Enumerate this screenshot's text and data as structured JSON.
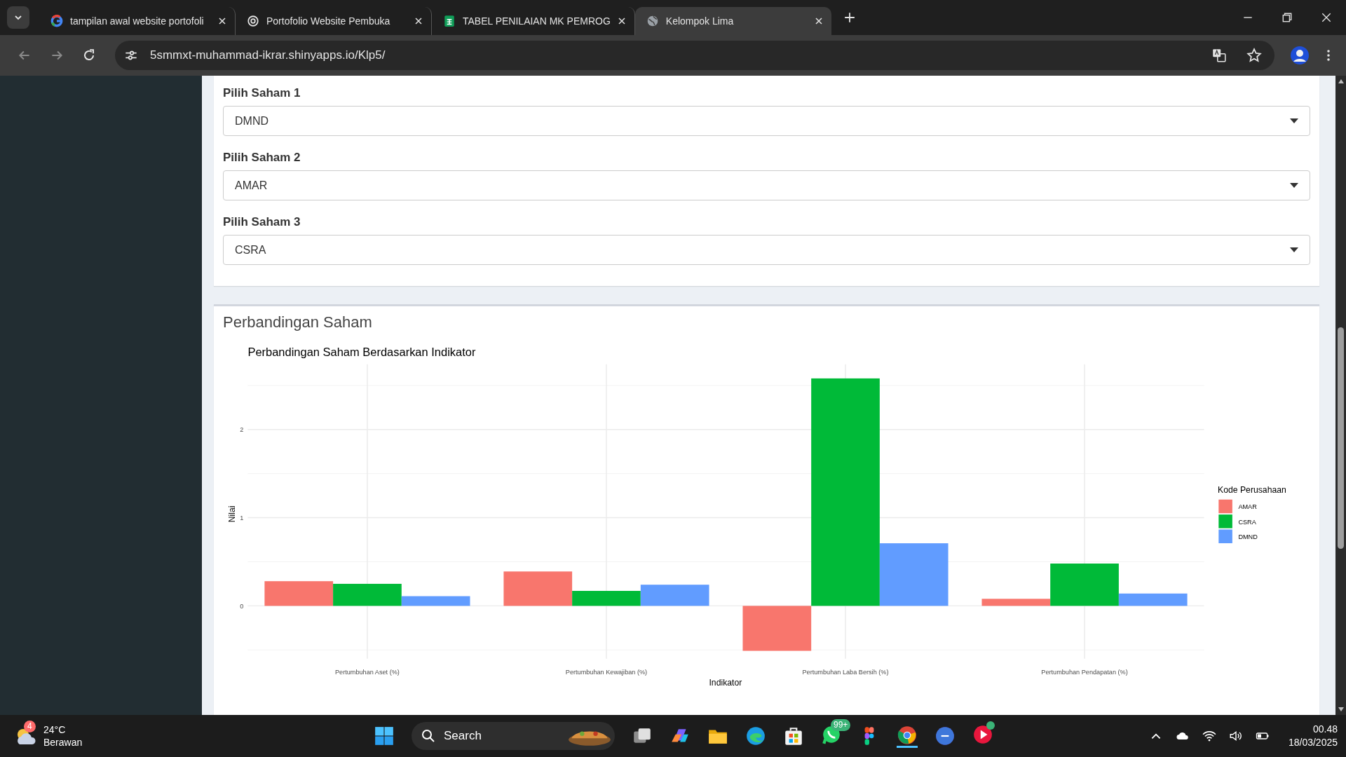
{
  "browser": {
    "tabs": [
      {
        "title": "tampilan awal website portofoli",
        "kind": "google",
        "selected": false
      },
      {
        "title": "Portofolio Website Pembuka",
        "kind": "openai",
        "selected": false
      },
      {
        "title": "TABEL PENILAIAN MK PEMROG",
        "kind": "sheets",
        "selected": false
      },
      {
        "title": "Kelompok Lima",
        "kind": "globe",
        "selected": true
      }
    ],
    "url": "5smmxt-muhammad-ikrar.shinyapps.io/Klp5/"
  },
  "selects": [
    {
      "label": "Pilih Saham 1",
      "value": "DMND"
    },
    {
      "label": "Pilih Saham 2",
      "value": "AMAR"
    },
    {
      "label": "Pilih Saham 3",
      "value": "CSRA"
    }
  ],
  "comparison": {
    "title": "Perbandingan Saham",
    "legend_title": "Kode Perusahaan",
    "chart_data": {
      "type": "bar",
      "title": "Perbandingan Saham Berdasarkan Indikator",
      "xlabel": "Indikator",
      "ylabel": "Nilai",
      "categories": [
        "Pertumbuhan Aset (%)",
        "Pertumbuhan Kewajiban (%)",
        "Pertumbuhan Laba Bersih (%)",
        "Pertumbuhan Pendapatan (%)"
      ],
      "series": [
        {
          "name": "AMAR",
          "color": "#f8766d",
          "values": [
            0.28,
            0.39,
            -0.51,
            0.08
          ]
        },
        {
          "name": "CSRA",
          "color": "#00ba38",
          "values": [
            0.25,
            0.17,
            2.58,
            0.48
          ]
        },
        {
          "name": "DMND",
          "color": "#619cff",
          "values": [
            0.11,
            0.24,
            0.71,
            0.14
          ]
        }
      ],
      "ylim": [
        -0.6,
        2.74
      ],
      "yticks": [
        0,
        1,
        2
      ],
      "grid": true,
      "legend": true
    }
  },
  "taskbar": {
    "weather_badge": "4",
    "temperature": "24°C",
    "weather": "Berawan",
    "search": "Search",
    "whatsapp_badge": "99+",
    "time": "00.48",
    "date": "18/03/2025"
  }
}
